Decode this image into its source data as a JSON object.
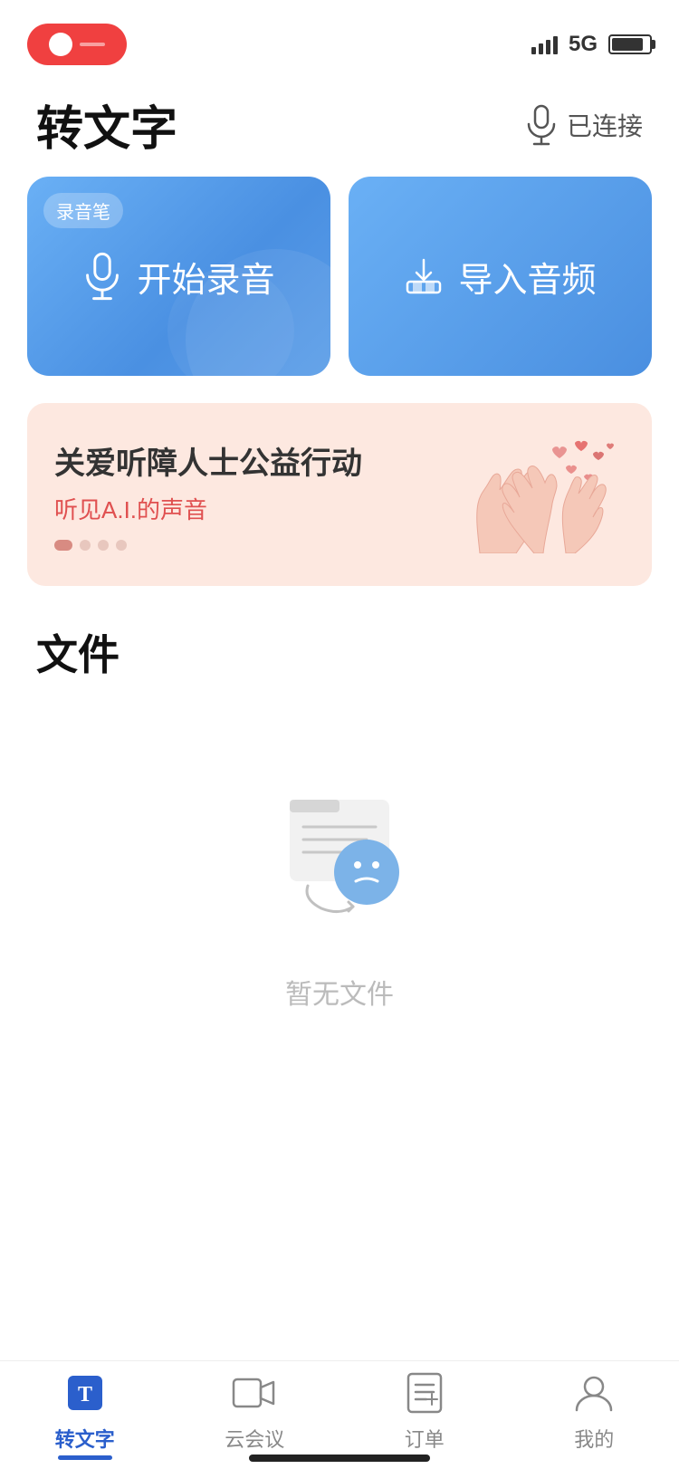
{
  "statusBar": {
    "signal": "5G",
    "bars": [
      8,
      12,
      16,
      20,
      24
    ]
  },
  "header": {
    "title": "转文字",
    "connectedLabel": "已连接"
  },
  "actionButtons": {
    "recordLabel": "录音笔",
    "recordText": "开始录音",
    "importText": "导入音频"
  },
  "banner": {
    "title": "关爱听障人士公益行动",
    "subtitle": "听见A.I.的声音"
  },
  "filesSection": {
    "title": "文件",
    "emptyText": "暂无文件"
  },
  "bottomNav": {
    "items": [
      {
        "id": "transcribe",
        "label": "转文字",
        "active": true
      },
      {
        "id": "meeting",
        "label": "云会议",
        "active": false
      },
      {
        "id": "orders",
        "label": "订单",
        "active": false
      },
      {
        "id": "mine",
        "label": "我的",
        "active": false
      }
    ]
  }
}
